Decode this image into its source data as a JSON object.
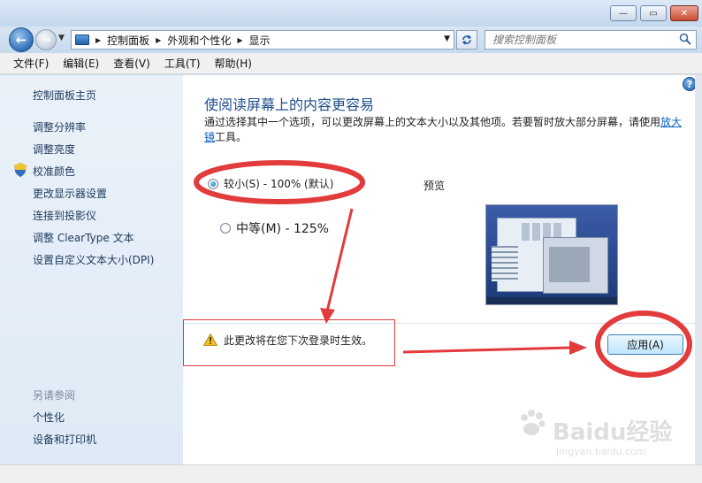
{
  "window": {
    "min_label": "—",
    "max_label": "▭",
    "close_label": "✕"
  },
  "nav": {
    "back": "←",
    "forward": "→",
    "breadcrumbs": [
      "控制面板",
      "外观和个性化",
      "显示"
    ],
    "search_placeholder": "搜索控制面板",
    "refresh_icon": "refresh-icon"
  },
  "menu": {
    "items": [
      "文件(F)",
      "编辑(E)",
      "查看(V)",
      "工具(T)",
      "帮助(H)"
    ]
  },
  "sidebar": {
    "home": "控制面板主页",
    "links": [
      "调整分辨率",
      "调整亮度",
      "校准颜色",
      "更改显示器设置",
      "连接到投影仪",
      "调整 ClearType 文本",
      "设置自定义文本大小(DPI)"
    ],
    "see_also_heading": "另请参阅",
    "see_also": [
      "个性化",
      "设备和打印机"
    ]
  },
  "main": {
    "title": "使阅读屏幕上的内容更容易",
    "desc_text": "通过选择其中一个选项，可以更改屏幕上的文本大小以及其他项。若要暂时放大部分屏幕，请使用",
    "desc_link": "放大镜",
    "desc_tail": "工具。",
    "options": [
      {
        "label": "较小(S) - 100% (默认)",
        "selected": true
      },
      {
        "label": "中等(M) - 125%",
        "selected": false
      }
    ],
    "preview_label": "预览",
    "warning": "此更改将在您下次登录时生效。",
    "apply": "应用(A)",
    "help": "?"
  },
  "watermark": {
    "brand": "Baidu经验",
    "url": "jingyan.baidu.com"
  },
  "colors": {
    "accent": "#1f4e8c",
    "annotation_red": "#e23b3b",
    "link": "#0b62c4"
  }
}
